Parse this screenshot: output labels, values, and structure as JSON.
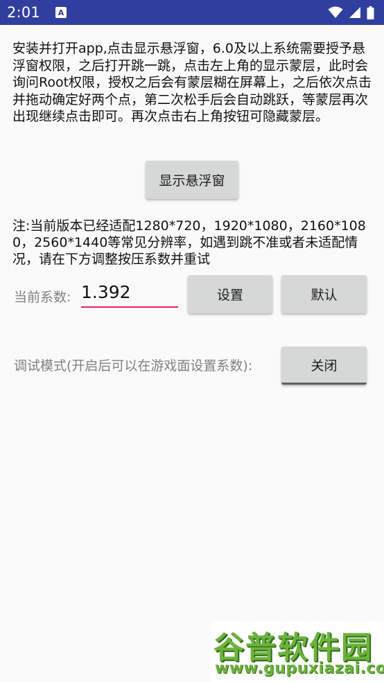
{
  "status_bar": {
    "time": "2:01",
    "notification_icon": "A",
    "icons": [
      "wifi-icon",
      "cellular-signal-icon",
      "battery-icon"
    ],
    "background_color": "#303f9f"
  },
  "intro": {
    "text": "安装并打开app,点击显示悬浮窗，6.0及以上系统需要授予悬浮窗权限，之后打开跳一跳，点击左上角的显示蒙层，此时会询问Root权限，授权之后会有蒙层糊在屏幕上，之后依次点击并拖动确定好两个点，第二次松手后会自动跳跃，等蒙层再次出现继续点击即可。再次点击右上角按钮可隐藏蒙层。"
  },
  "show_float_button": {
    "label": "显示悬浮窗"
  },
  "note": {
    "text": "注:当前版本已经适配1280*720，1920*1080，2160*1080，2560*1440等常见分辨率，如遇到跳不准或者未适配情况，请在下方调整按压系数并重试"
  },
  "coefficient": {
    "label": "当前系数:",
    "value": "1.392",
    "underline_color": "#e91e63",
    "set_button": "设置",
    "default_button": "默认"
  },
  "debug": {
    "label": "调试模式(开启后可以在游戏面设置系数):",
    "toggle_label": "关闭"
  },
  "watermark": {
    "title": "谷普软件园",
    "url": "www.gupuxiazai.com",
    "color": "#6cb33e"
  }
}
